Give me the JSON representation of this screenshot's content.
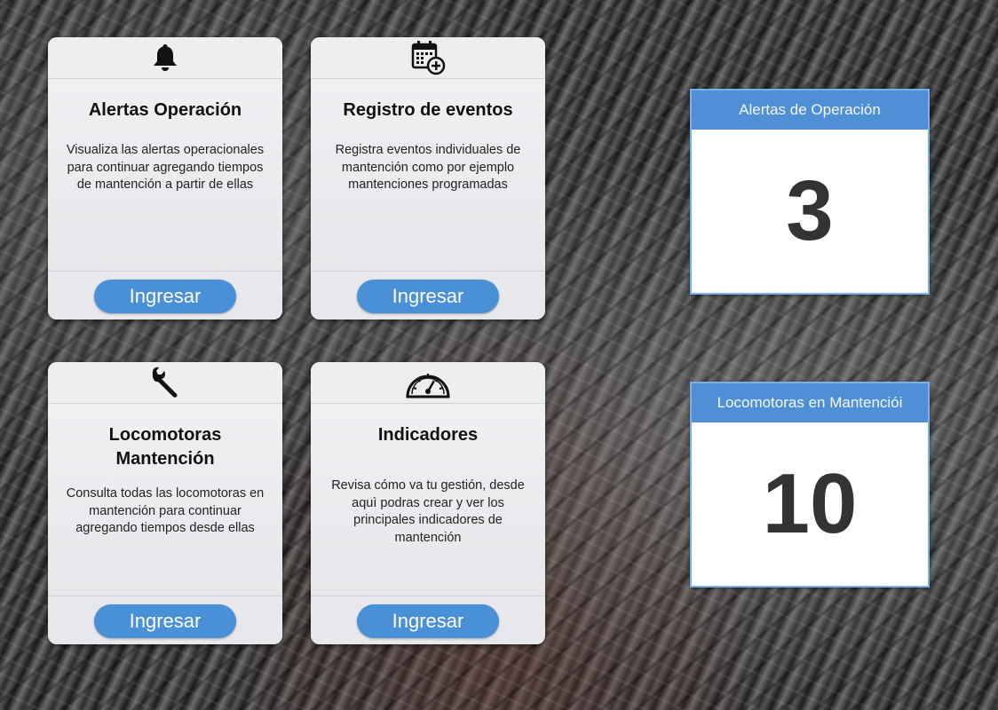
{
  "cards": [
    {
      "icon": "bell-icon",
      "title": "Alertas Operación",
      "description": "Visualiza las alertas operacionales para continuar agregando tiempos de mantención a partir de ellas",
      "button": "Ingresar"
    },
    {
      "icon": "calendar-add-icon",
      "title": "Registro de eventos",
      "description": "Registra eventos individuales de mantención como por ejemplo mantenciones programadas",
      "button": "Ingresar"
    },
    {
      "icon": "wrench-icon",
      "title": "Locomotoras Mantención",
      "description": "Consulta todas las locomotoras en mantención para continuar agregando tiempos desde ellas",
      "button": "Ingresar"
    },
    {
      "icon": "gauge-icon",
      "title": "Indicadores",
      "description": "Revisa cómo va tu gestión, desde aquì podras crear y ver los principales indicadores de mantención",
      "button": "Ingresar"
    }
  ],
  "stats": [
    {
      "label": "Alertas de Operación",
      "value": "3"
    },
    {
      "label": "Locomotoras en Mantenciói",
      "value": "10"
    }
  ],
  "colors": {
    "accent": "#4a90d6",
    "stat_header": "#4f8fd6"
  }
}
